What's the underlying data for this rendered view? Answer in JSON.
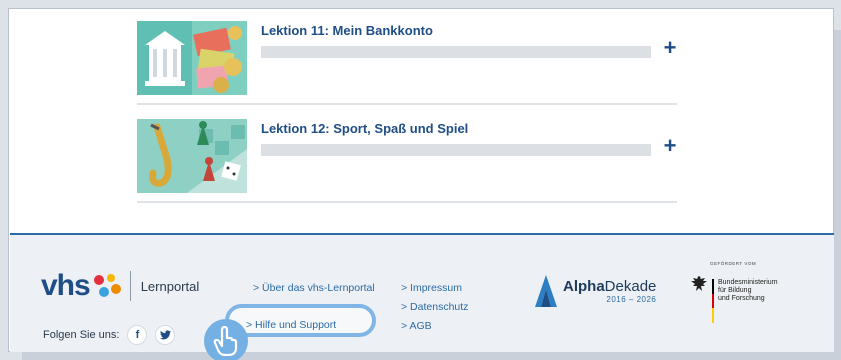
{
  "lessons": [
    {
      "title": "Lektion 11: Mein Bankkonto",
      "expand_icon": "plus-icon"
    },
    {
      "title": "Lektion 12: Sport, Spaß und Spiel",
      "expand_icon": "plus-icon"
    }
  ],
  "footer": {
    "logo_text": "vhs",
    "portal_label": "Lernportal",
    "follow_label": "Folgen Sie uns:",
    "social": [
      {
        "label": "f",
        "icon": "facebook-icon"
      },
      {
        "label": "🐦",
        "icon": "twitter-icon"
      }
    ],
    "links_col1": [
      "> Über das vhs-Lernportal",
      "> Hilfe und Support"
    ],
    "links_col2": [
      "> Impressum",
      "> Datenschutz",
      "> AGB"
    ],
    "alpha": {
      "name_bold": "Alpha",
      "name_rest": "Dekade",
      "years": "2016 – 2026"
    },
    "bmbf": {
      "top": "GEFÖRDERT VOM",
      "line1": "Bundesministerium",
      "line2": "für Bildung",
      "line3": "und Forschung"
    }
  },
  "colors": {
    "primary": "#1f4e86",
    "link": "#2c6ba4",
    "highlight": "#7fb6e6",
    "footer_bg": "#edf0f4"
  }
}
